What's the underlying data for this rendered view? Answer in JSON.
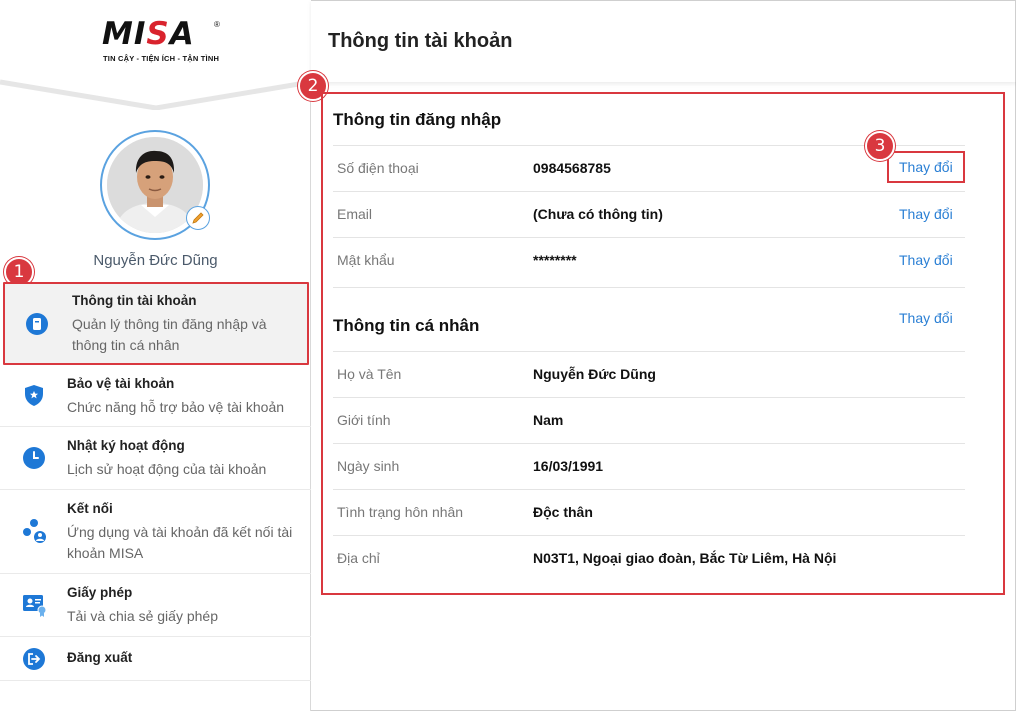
{
  "brand": {
    "logo_text_left": "MI",
    "logo_text_s": "S",
    "logo_text_right": "A",
    "logo_reg": "®",
    "tagline": "TIN CẬY - TIỆN ÍCH - TẬN TÌNH"
  },
  "user": {
    "name": "Nguyễn Đức Dũng"
  },
  "sidebar": {
    "items": [
      {
        "title": "Thông tin tài khoản",
        "desc": "Quản lý thông tin đăng nhập và thông tin cá nhân",
        "icon": "account-info-icon"
      },
      {
        "title": "Bảo vệ tài khoản",
        "desc": "Chức năng hỗ trợ bảo vệ tài khoản",
        "icon": "shield-icon"
      },
      {
        "title": "Nhật ký hoạt động",
        "desc": "Lịch sử hoạt động của tài khoản",
        "icon": "clock-icon"
      },
      {
        "title": "Kết nối",
        "desc": "Ứng dụng và tài khoản đã kết nối tài khoản MISA",
        "icon": "connect-icon"
      },
      {
        "title": "Giấy phép",
        "desc": "Tải và chia sẻ giấy phép",
        "icon": "license-icon"
      },
      {
        "title": "Đăng xuất",
        "desc": "",
        "icon": "logout-icon"
      }
    ]
  },
  "main": {
    "title": "Thông tin tài khoản",
    "login_section": {
      "title": "Thông tin đăng nhập",
      "rows": [
        {
          "label": "Số điện thoại",
          "value": "0984568785",
          "action": "Thay đổi"
        },
        {
          "label": "Email",
          "value": "(Chưa có thông tin)",
          "action": "Thay đổi"
        },
        {
          "label": "Mật khẩu",
          "value": "********",
          "action": "Thay đổi"
        }
      ]
    },
    "personal_section": {
      "title": "Thông tin cá nhân",
      "action": "Thay đổi",
      "rows": [
        {
          "label": "Họ và Tên",
          "value": "Nguyễn Đức Dũng"
        },
        {
          "label": "Giới tính",
          "value": "Nam"
        },
        {
          "label": "Ngày sinh",
          "value": "16/03/1991"
        },
        {
          "label": "Tình trạng hôn nhân",
          "value": "Độc thân"
        },
        {
          "label": "Địa chỉ",
          "value": "N03T1, Ngoại giao đoàn, Bắc Từ Liêm, Hà Nội"
        }
      ]
    }
  },
  "annotations": {
    "badge1": "1",
    "badge2": "2",
    "badge3": "3"
  },
  "colors": {
    "accent": "#2a7fd4",
    "highlight": "#d9383f",
    "icon_blue": "#1e78d6"
  }
}
